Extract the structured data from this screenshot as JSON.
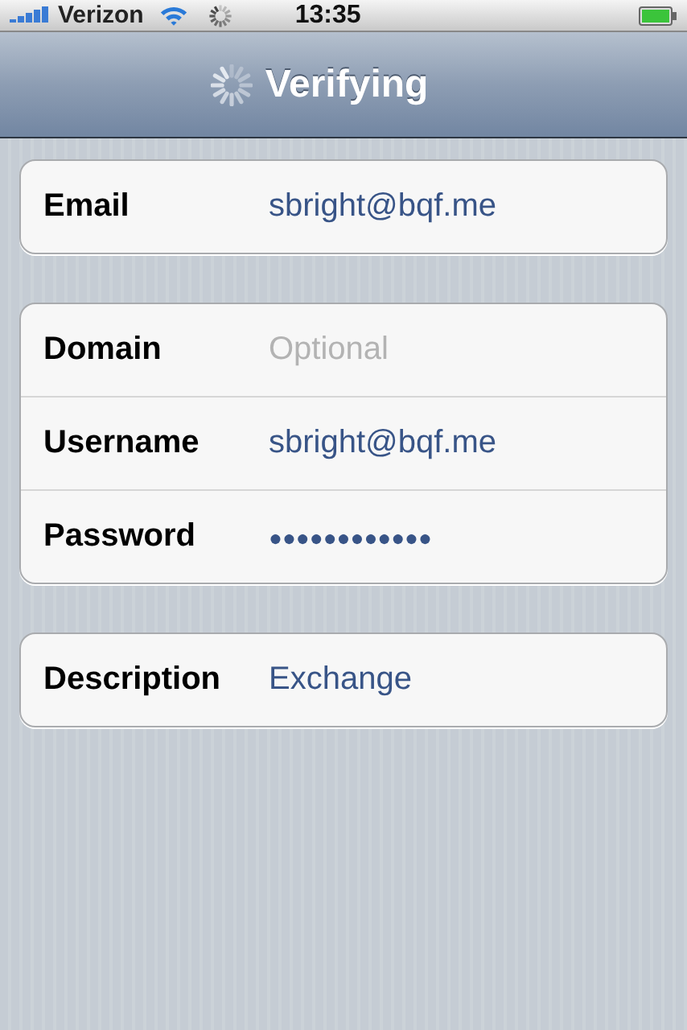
{
  "status_bar": {
    "carrier": "Verizon",
    "time": "13:35"
  },
  "nav_bar": {
    "title": "Verifying"
  },
  "groups": [
    {
      "rows": [
        {
          "label": "Email",
          "kind": "text",
          "value": "sbright@bqf.me"
        }
      ]
    },
    {
      "rows": [
        {
          "label": "Domain",
          "kind": "text",
          "placeholder": "Optional"
        },
        {
          "label": "Username",
          "kind": "text",
          "value": "sbright@bqf.me"
        },
        {
          "label": "Password",
          "kind": "password",
          "value": "●●●●●●●●●●●●"
        }
      ]
    },
    {
      "rows": [
        {
          "label": "Description",
          "kind": "text",
          "value": "Exchange"
        }
      ]
    }
  ]
}
